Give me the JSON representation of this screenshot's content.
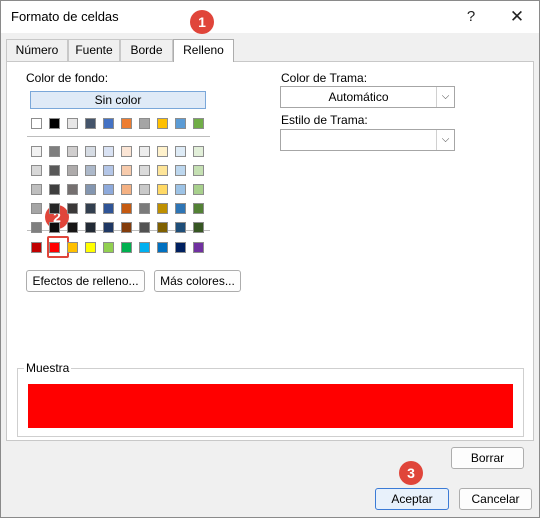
{
  "window": {
    "title": "Formato de celdas",
    "help_glyph": "?",
    "close_glyph": "✕"
  },
  "tabs": [
    {
      "label": "Número",
      "active": false
    },
    {
      "label": "Fuente",
      "active": false
    },
    {
      "label": "Borde",
      "active": false
    },
    {
      "label": "Relleno",
      "active": true
    }
  ],
  "fill": {
    "color_label": "Color de fondo:",
    "no_color": "Sin color",
    "basic_row": [
      "#ffffff",
      "#000000",
      "#e7e6e6",
      "#44546a",
      "#4472c4",
      "#ed7d31",
      "#a5a5a5",
      "#ffc000",
      "#5b9bd5",
      "#70ad47"
    ],
    "theme_rows": [
      [
        "#f2f2f2",
        "#7f7f7f",
        "#d0cece",
        "#d6dce4",
        "#d9e2f3",
        "#fbe5d5",
        "#ededed",
        "#fff2cc",
        "#deebf6",
        "#e2efd9"
      ],
      [
        "#d8d8d8",
        "#595959",
        "#aeabab",
        "#adb9ca",
        "#b4c6e7",
        "#f7cbac",
        "#dbdbdb",
        "#fee599",
        "#bdd7ee",
        "#c5e0b3"
      ],
      [
        "#bfbfbf",
        "#3f3f3f",
        "#757070",
        "#8496b0",
        "#8eaadb",
        "#f4b183",
        "#c9c9c9",
        "#ffd965",
        "#9dc3e6",
        "#a8d08d"
      ],
      [
        "#a5a5a5",
        "#262626",
        "#3a3838",
        "#323f4f",
        "#2f5496",
        "#c55a11",
        "#7b7b7b",
        "#bf9000",
        "#2e75b5",
        "#538135"
      ],
      [
        "#7f7f7f",
        "#0c0c0c",
        "#171616",
        "#222a35",
        "#1f3864",
        "#833c0b",
        "#525252",
        "#7f6000",
        "#1f4e79",
        "#375623"
      ]
    ],
    "standard_row": [
      "#c00000",
      "#ff0000",
      "#ffc000",
      "#ffff00",
      "#92d050",
      "#00b050",
      "#00b0f0",
      "#0070c0",
      "#002060",
      "#7030a0"
    ],
    "selected_color": "#ff0000",
    "effects_button": "Efectos de relleno...",
    "more_colors_button": "Más colores...",
    "pattern_color_label": "Color de Trama:",
    "pattern_color_value": "Automático",
    "pattern_style_label": "Estilo de Trama:",
    "pattern_style_value": ""
  },
  "sample": {
    "label": "Muestra",
    "color": "#ff0000"
  },
  "buttons": {
    "clear": "Borrar",
    "ok": "Aceptar",
    "cancel": "Cancelar"
  },
  "annotations": [
    {
      "number": "1",
      "color": "#e0453a"
    },
    {
      "number": "2",
      "color": "#e0453a"
    },
    {
      "number": "3",
      "color": "#e0453a"
    }
  ]
}
